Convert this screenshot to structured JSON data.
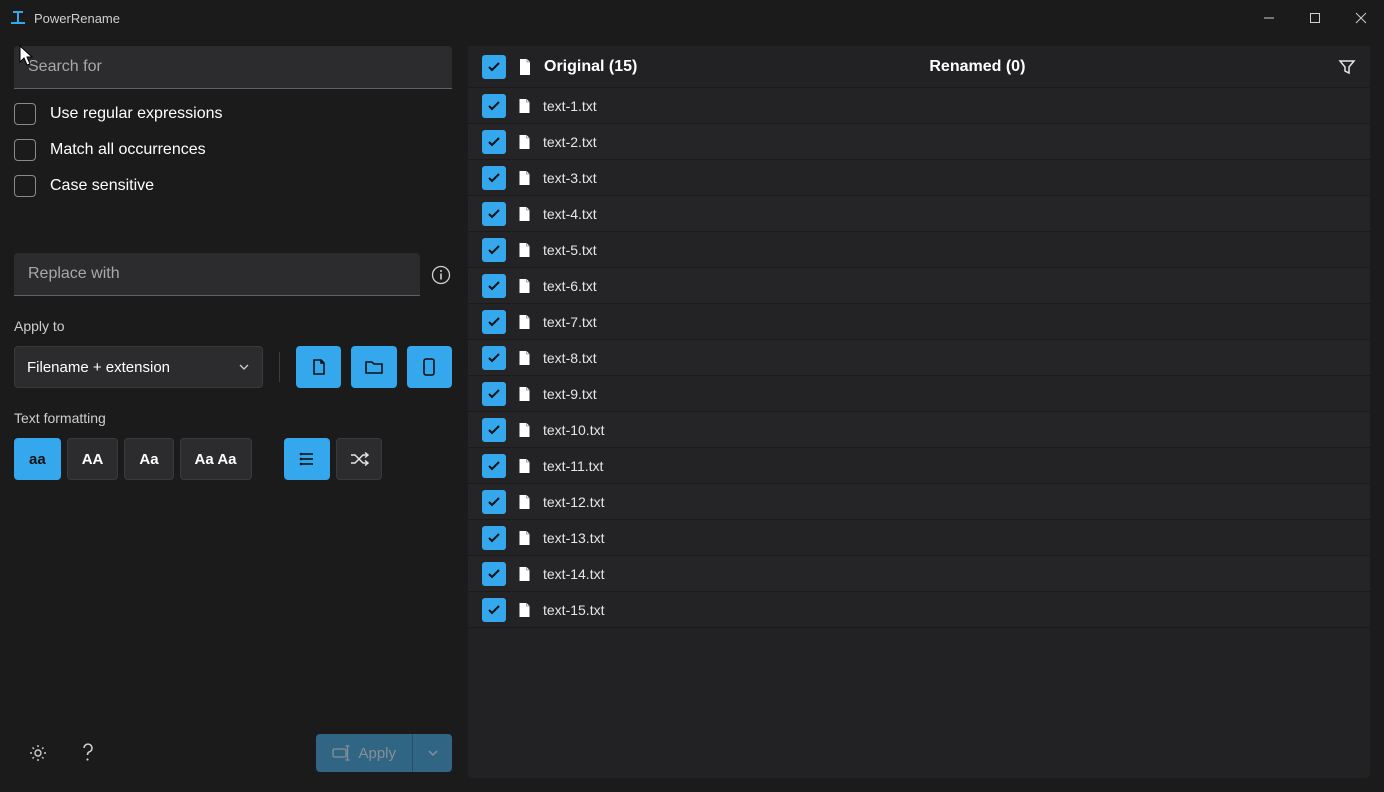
{
  "window": {
    "title": "PowerRename"
  },
  "left": {
    "search_placeholder": "Search for",
    "options": [
      "Use regular expressions",
      "Match all occurrences",
      "Case sensitive"
    ],
    "replace_placeholder": "Replace with",
    "apply_to_label": "Apply to",
    "apply_to_value": "Filename + extension",
    "text_formatting_label": "Text formatting",
    "format_buttons": [
      "aa",
      "AA",
      "Aa",
      "Aa Aa"
    ],
    "apply_label": "Apply"
  },
  "header": {
    "original_label": "Original",
    "original_count": 15,
    "renamed_label": "Renamed",
    "renamed_count": 0
  },
  "files": [
    {
      "name": "text-1.txt",
      "checked": true
    },
    {
      "name": "text-2.txt",
      "checked": true
    },
    {
      "name": "text-3.txt",
      "checked": true
    },
    {
      "name": "text-4.txt",
      "checked": true
    },
    {
      "name": "text-5.txt",
      "checked": true
    },
    {
      "name": "text-6.txt",
      "checked": true
    },
    {
      "name": "text-7.txt",
      "checked": true
    },
    {
      "name": "text-8.txt",
      "checked": true
    },
    {
      "name": "text-9.txt",
      "checked": true
    },
    {
      "name": "text-10.txt",
      "checked": true
    },
    {
      "name": "text-11.txt",
      "checked": true
    },
    {
      "name": "text-12.txt",
      "checked": true
    },
    {
      "name": "text-13.txt",
      "checked": true
    },
    {
      "name": "text-14.txt",
      "checked": true
    },
    {
      "name": "text-15.txt",
      "checked": true
    }
  ]
}
